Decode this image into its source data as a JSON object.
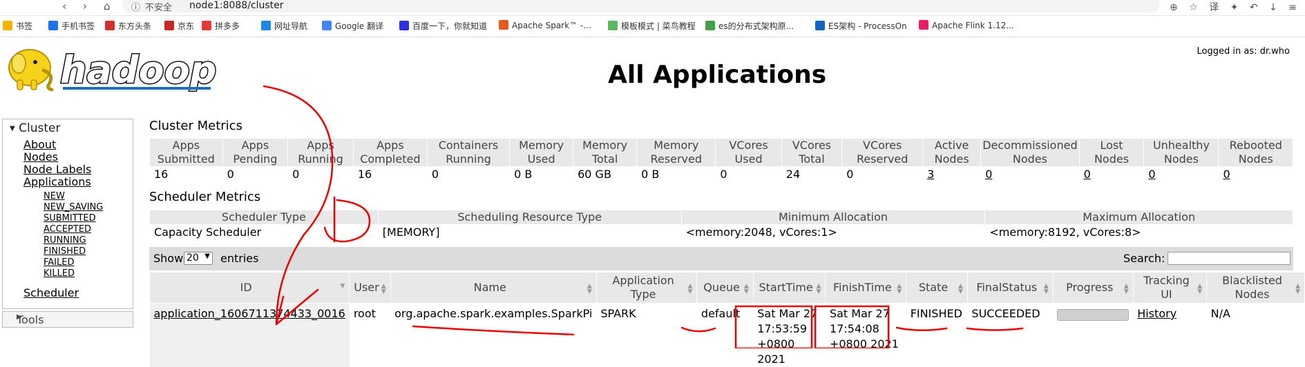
{
  "browser": {
    "insecure_label": "不安全",
    "url": "node1:8088/cluster"
  },
  "bookmarks": [
    {
      "label": "书签",
      "color": "#f2b400"
    },
    {
      "label": "手机书签",
      "color": "#1a73e8"
    },
    {
      "label": "东方头条",
      "color": "#d32f2f"
    },
    {
      "label": "京东",
      "color": "#c62828"
    },
    {
      "label": "拼多多",
      "color": "#e53935"
    },
    {
      "label": "网址导航",
      "color": "#1e88e5"
    },
    {
      "label": "Google 翻译",
      "color": "#4285f4"
    },
    {
      "label": "百度一下，你就知道",
      "color": "#2932e1"
    },
    {
      "label": "Apache Spark™ -...",
      "color": "#e25a1c"
    },
    {
      "label": "模板模式 | 菜鸟教程",
      "color": "#5cb85c"
    },
    {
      "label": "es的分布式架构原...",
      "color": "#43a047"
    },
    {
      "label": "ES架构 - ProcessOn",
      "color": "#1565c0"
    },
    {
      "label": "Apache Flink 1.12...",
      "color": "#e91e63"
    }
  ],
  "header": {
    "logo_text": "hadoop",
    "logged_in": "Logged in as: dr.who",
    "title": "All Applications"
  },
  "sidebar": {
    "cluster_label": "Cluster",
    "links": [
      "About",
      "Nodes",
      "Node Labels",
      "Applications"
    ],
    "states": [
      "NEW",
      "NEW_SAVING",
      "SUBMITTED",
      "ACCEPTED",
      "RUNNING",
      "FINISHED",
      "FAILED",
      "KILLED"
    ],
    "scheduler": "Scheduler",
    "tools": "Tools"
  },
  "cluster_metrics": {
    "title": "Cluster Metrics",
    "headers": [
      [
        "Apps",
        "Submitted"
      ],
      [
        "Apps",
        "Pending"
      ],
      [
        "Apps",
        "Running"
      ],
      [
        "Apps",
        "Completed"
      ],
      [
        "Containers",
        "Running"
      ],
      [
        "Memory",
        "Used"
      ],
      [
        "Memory",
        "Total"
      ],
      [
        "Memory",
        "Reserved"
      ],
      [
        "VCores",
        "Used"
      ],
      [
        "VCores",
        "Total"
      ],
      [
        "VCores",
        "Reserved"
      ],
      [
        "Active",
        "Nodes"
      ],
      [
        "Decommissioned",
        "Nodes"
      ],
      [
        "Lost",
        "Nodes"
      ],
      [
        "Unhealthy",
        "Nodes"
      ],
      [
        "Rebooted",
        "Nodes"
      ]
    ],
    "values": [
      "16",
      "0",
      "0",
      "16",
      "0",
      "0 B",
      "60 GB",
      "0 B",
      "0",
      "24",
      "0",
      "3",
      "0",
      "0",
      "0",
      "0"
    ]
  },
  "scheduler_metrics": {
    "title": "Scheduler Metrics",
    "headers": [
      "Scheduler Type",
      "Scheduling Resource Type",
      "Minimum Allocation",
      "Maximum Allocation"
    ],
    "values": [
      "Capacity Scheduler",
      "[MEMORY]",
      "<memory:2048, vCores:1>",
      "<memory:8192, vCores:8>"
    ]
  },
  "table_controls": {
    "show": "Show",
    "page_size": "20",
    "entries": "entries",
    "search": "Search:"
  },
  "apps": {
    "headers": [
      [
        "ID"
      ],
      [
        "User"
      ],
      [
        "Name"
      ],
      [
        "Application Type"
      ],
      [
        "Queue"
      ],
      [
        "StartTime"
      ],
      [
        "FinishTime"
      ],
      [
        "State"
      ],
      [
        "FinalStatus"
      ],
      [
        "Progress"
      ],
      [
        "Tracking",
        "UI"
      ],
      [
        "Blacklisted",
        "Nodes"
      ]
    ],
    "row": {
      "id": "application_1606711374433_0016",
      "user": "root",
      "name": "org.apache.spark.examples.SparkPi",
      "type": "SPARK",
      "queue": "default",
      "start": [
        "Sat Mar 27",
        "17:53:59",
        "+0800 2021"
      ],
      "finish": [
        "Sat Mar 27",
        "17:54:08",
        "+0800 2021"
      ],
      "state": "FINISHED",
      "final_status": "SUCCEEDED",
      "progress": 1.0,
      "tracking": "History",
      "blacklisted": "N/A"
    }
  }
}
